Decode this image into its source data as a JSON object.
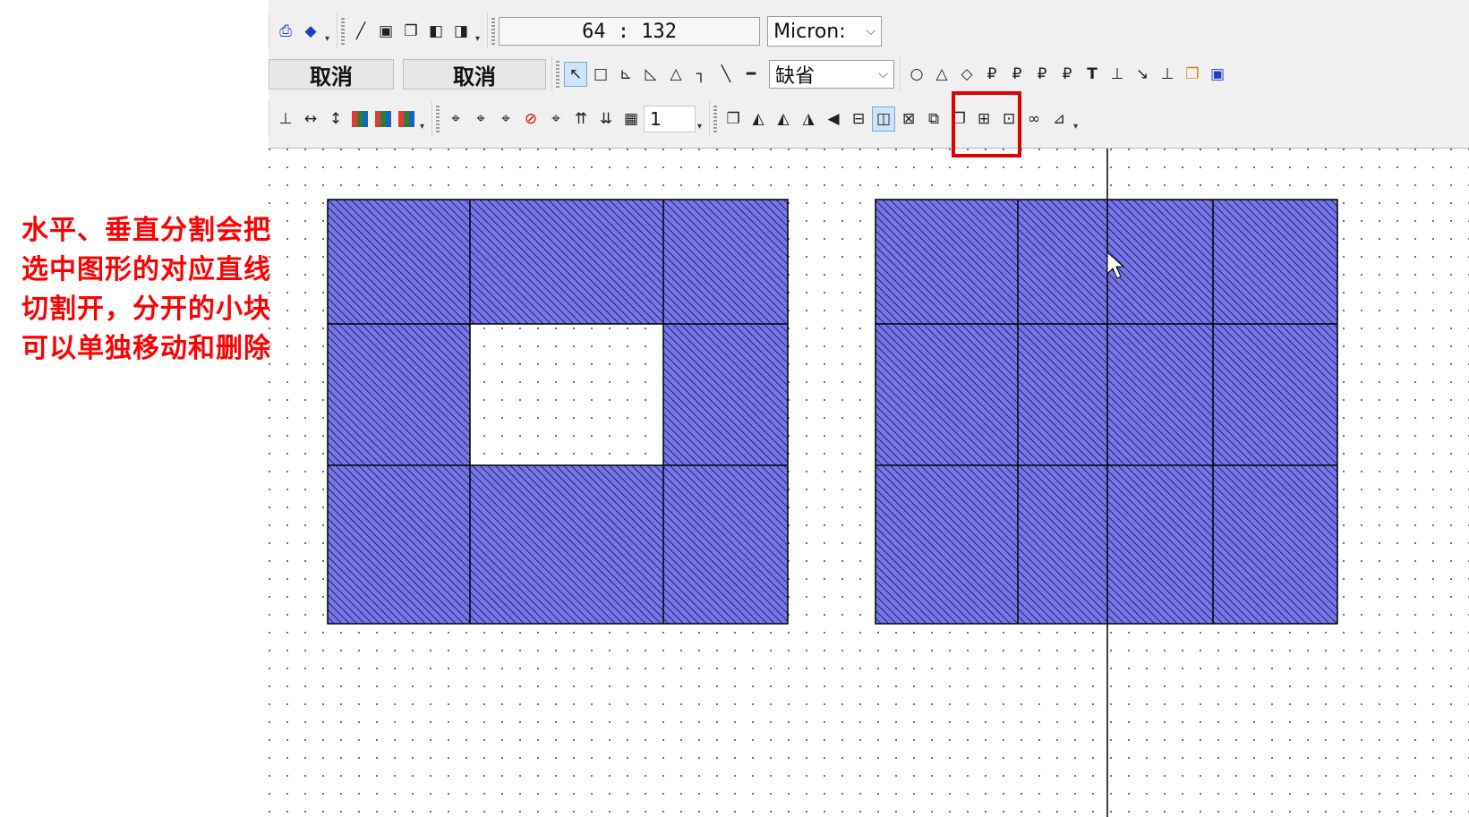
{
  "annotation": {
    "lines": [
      "水平、垂直分割会把",
      "选中图形的对应直线",
      "切割开，分开的小块",
      "可以单独移动和删除"
    ],
    "color": "#ff0000"
  },
  "toolbar": {
    "row1": {
      "icons": [
        "print-icon",
        "book-icon",
        "pencil-icon",
        "save-icon",
        "stack-icon",
        "layer-in-icon",
        "layer-out-icon"
      ],
      "coordinate": "64 : 132",
      "unit_select": "Micron:"
    },
    "row2": {
      "cancel_labels": [
        "取消",
        "取消"
      ],
      "tools": [
        "select-arrow-icon",
        "rectangle-icon",
        "polygon-icon",
        "trapezoid-icon",
        "triangle-icon",
        "path-icon",
        "line-icon",
        "wire-icon"
      ],
      "layer_select": "缺省",
      "shape_tools": [
        "circle-icon",
        "triangle-outline-icon",
        "diamond-icon",
        "pin1-icon",
        "pin2-icon",
        "pin3-icon",
        "pin4-icon",
        "text-icon",
        "ruler-icon",
        "snap-icon",
        "ruler2-icon",
        "layers-icon",
        "fill-icon"
      ],
      "text_icon_label": "T"
    },
    "row3": {
      "icons": [
        "align-bottom-icon",
        "dimension-h-icon",
        "dimension-v-icon",
        "color-bars-icon",
        "color-stack-icon",
        "color-grid-icon",
        "snap1-icon",
        "snap2-icon",
        "snap3-icon",
        "no-snap-icon",
        "mfg-icon",
        "array-up-icon",
        "array-down-icon",
        "array-grid-icon"
      ],
      "number_value": "1",
      "ops": [
        "copy-icon",
        "flip-h-icon",
        "flip-h2-icon",
        "mirror-icon",
        "arrow-left-icon",
        "horizontal-split-icon",
        "vertical-split-icon",
        "delete-rect-icon",
        "group-icon",
        "clone-icon",
        "merge-icon",
        "ungroup-icon",
        "glasses-icon",
        "measure-icon"
      ],
      "selected_op": "vertical-split-icon"
    }
  },
  "canvas": {
    "fill_color": "#7575e0",
    "hatch_color": "#1c1c8c",
    "cursor_line": true
  }
}
